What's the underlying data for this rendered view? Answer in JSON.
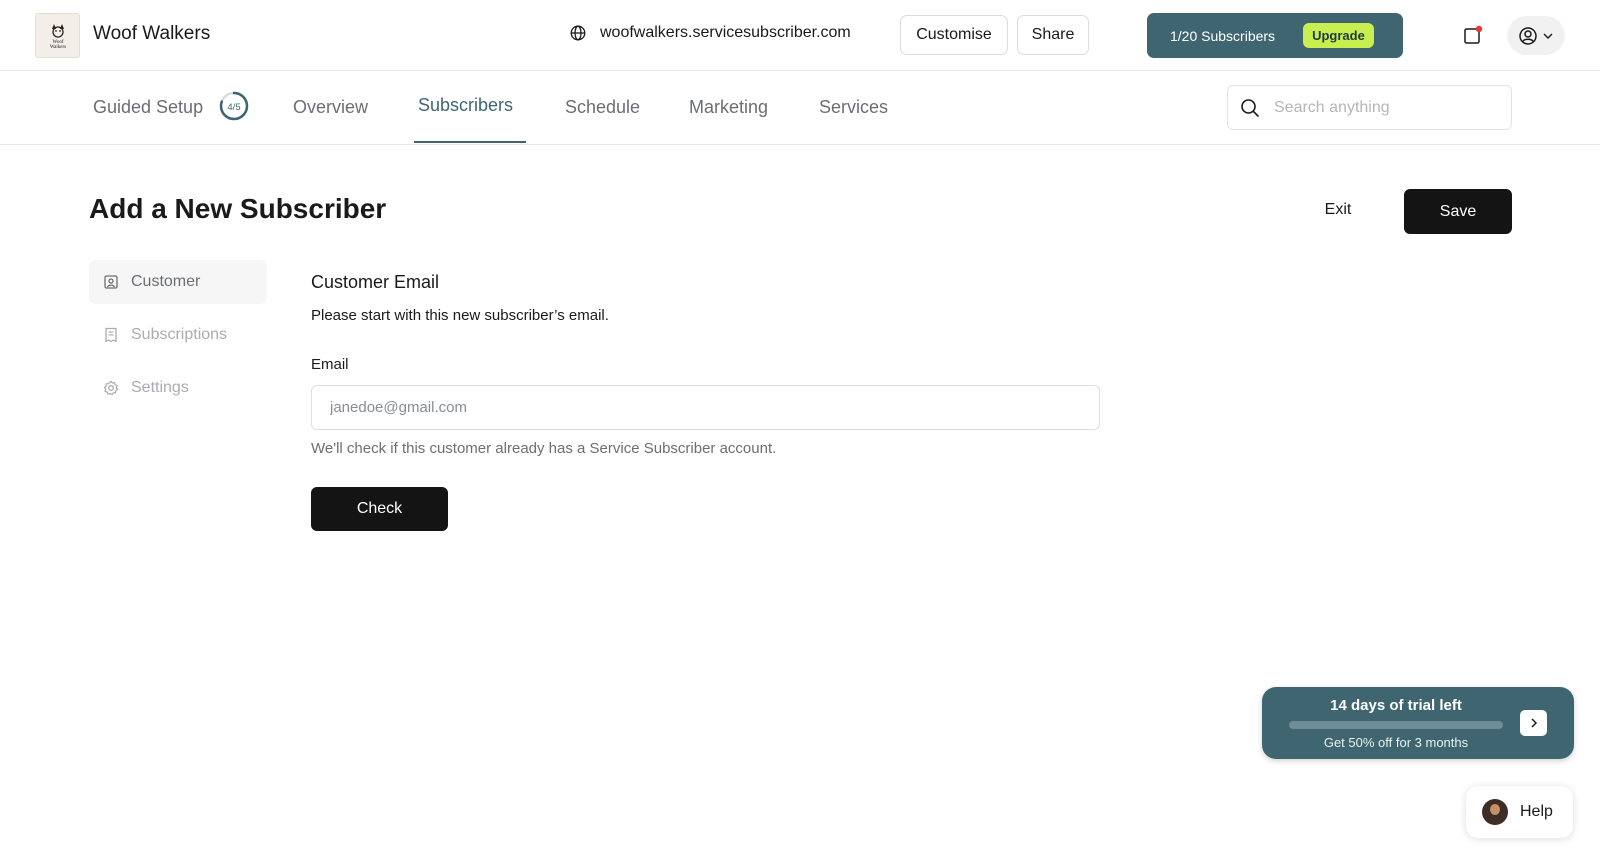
{
  "header": {
    "brand_name": "Woof Walkers",
    "logo_text": "Woof Walkers",
    "site_url": "woofwalkers.servicesubscriber.com",
    "customise_label": "Customise",
    "share_label": "Share",
    "plan_usage": "1/20 Subscribers",
    "upgrade_label": "Upgrade",
    "notification_icon": "notification-icon",
    "account_icon": "account-icon",
    "colors": {
      "accent": "#3f6670",
      "upgrade": "#c8ee4f",
      "notification_dot": "#e53935"
    }
  },
  "nav": {
    "tabs": [
      {
        "label": "Guided Setup",
        "badge": "4/5"
      },
      {
        "label": "Overview"
      },
      {
        "label": "Subscribers",
        "active": true
      },
      {
        "label": "Schedule"
      },
      {
        "label": "Marketing"
      },
      {
        "label": "Services"
      }
    ],
    "guided_setup_progress": 0.8,
    "search_placeholder": "Search anything"
  },
  "page": {
    "title": "Add a New Subscriber",
    "exit_label": "Exit",
    "save_label": "Save"
  },
  "sidebar": {
    "items": [
      {
        "label": "Customer",
        "icon": "customer-icon",
        "active": true
      },
      {
        "label": "Subscriptions",
        "icon": "receipt-icon"
      },
      {
        "label": "Settings",
        "icon": "gear-icon"
      }
    ]
  },
  "form": {
    "section_title": "Customer Email",
    "section_description": "Please start with this new subscriber’s email.",
    "email_label": "Email",
    "email_placeholder": "janedoe@gmail.com",
    "email_value": "",
    "hint": "We'll check if this customer already has a Service Subscriber account.",
    "check_label": "Check"
  },
  "trial": {
    "title": "14 days of trial left",
    "subtitle": "Get 50% off for 3 months",
    "progress": 0.0
  },
  "help": {
    "label": "Help"
  }
}
